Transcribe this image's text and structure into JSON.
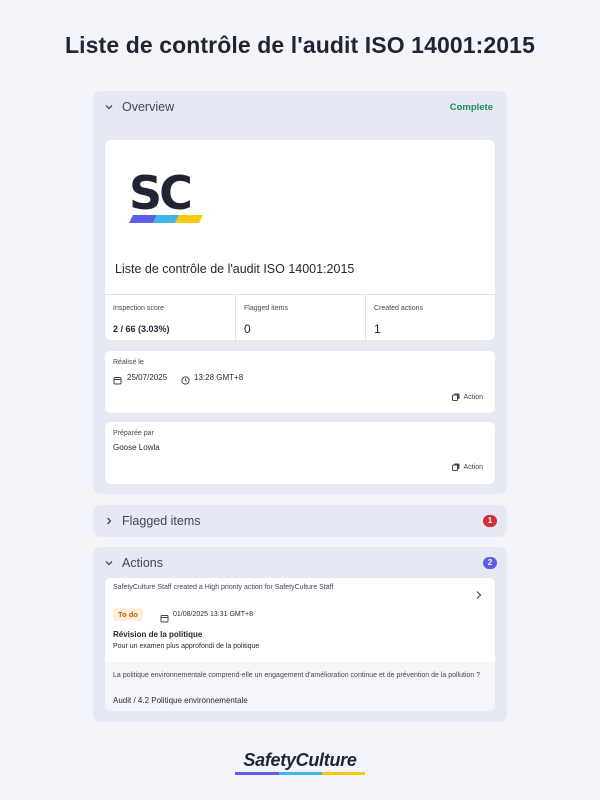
{
  "page_title": "Liste de contrôle de l'audit ISO 14001:2015",
  "overview": {
    "title": "Overview",
    "status": "Complete",
    "logo_text": "SC",
    "document_title": "Liste de contrôle de l'audit ISO 14001:2015",
    "stats": [
      {
        "label": "Inspection score",
        "value": "2 / 66 (3.03%)"
      },
      {
        "label": "Flagged items",
        "value": "0"
      },
      {
        "label": "Created actions",
        "value": "1"
      }
    ],
    "realise": {
      "label": "Réalisé le",
      "date": "25/07/2025",
      "time": "13:28 GMT+8",
      "action": "Action"
    },
    "prepare": {
      "label": "Préparée par",
      "value": "Goose Lowla",
      "action": "Action"
    }
  },
  "flagged": {
    "title": "Flagged items",
    "count": "1"
  },
  "actions": {
    "title": "Actions",
    "count": "2",
    "item": {
      "created_by": "SafetyCulture Staff created a High priority action for SafetyCulture Staff",
      "status": "To do",
      "due": "01/08/2025 13:31 GMT+8",
      "title": "Révision de la politique",
      "description": "Pour un examen plus approfondi de la politique",
      "question": "La politique environnementale comprend-elle un engagement d'amélioration continue et de prévention de la pollution ?",
      "path": "Audit / 4.2 Politique environnementale"
    }
  },
  "footer": {
    "brand": "SafetyCulture"
  },
  "colors": {
    "complete": "#1f8a5a",
    "flag_badge": "#d32f3b",
    "actions_badge": "#5b5fe6",
    "todo_bg": "#fdefd9"
  }
}
